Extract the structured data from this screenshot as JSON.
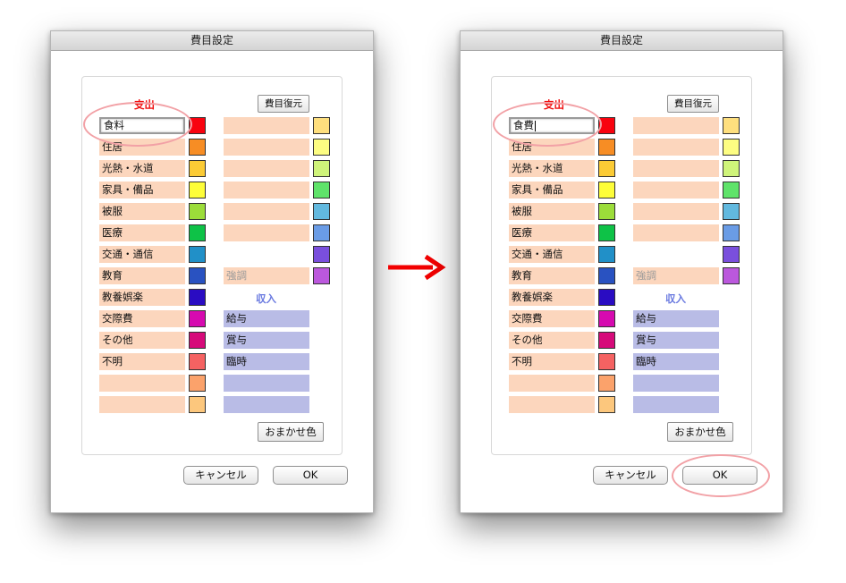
{
  "dialog_title": "費目設定",
  "expense_label": "支出",
  "income_label": "収入",
  "restore_button": "費目復元",
  "auto_color_button": "おまかせ色",
  "cancel_button": "キャンセル",
  "ok_button": "OK",
  "expense_fields_left": [
    "食料",
    "住居",
    "光熱・水道",
    "家具・備品",
    "被服",
    "医療",
    "交通・通信",
    "教育",
    "教養娯楽",
    "交際費",
    "その他",
    "不明",
    "",
    ""
  ],
  "expense_fields_left_after": [
    "食費",
    "住居",
    "光熱・水道",
    "家具・備品",
    "被服",
    "医療",
    "交通・通信",
    "教育",
    "教養娯楽",
    "交際費",
    "その他",
    "不明",
    "",
    ""
  ],
  "expense_fields_right": [
    "",
    "",
    "",
    "",
    "",
    ""
  ],
  "emphasis_field": "強調",
  "income_fields": [
    "給与",
    "賞与",
    "臨時",
    "",
    ""
  ],
  "left_swatch_colors": [
    "#f8030f",
    "#f78d24",
    "#fbcb35",
    "#fdfd39",
    "#9cdd3a",
    "#0ec247",
    "#2190c8",
    "#2952c1",
    "#2a0cc2",
    "#d60ab0",
    "#d60a7a",
    "#f56262",
    "#fba26b",
    "#fcc77d"
  ],
  "right_swatch_colors": [
    "#fedf7e",
    "#fdfd82",
    "#cff47a",
    "#5fe36a",
    "#62b9df",
    "#6a9ce6",
    "#7a4fdd",
    "#bb58dd"
  ],
  "accent_red": "#ff0000",
  "callout_color": "#f2a1a6"
}
